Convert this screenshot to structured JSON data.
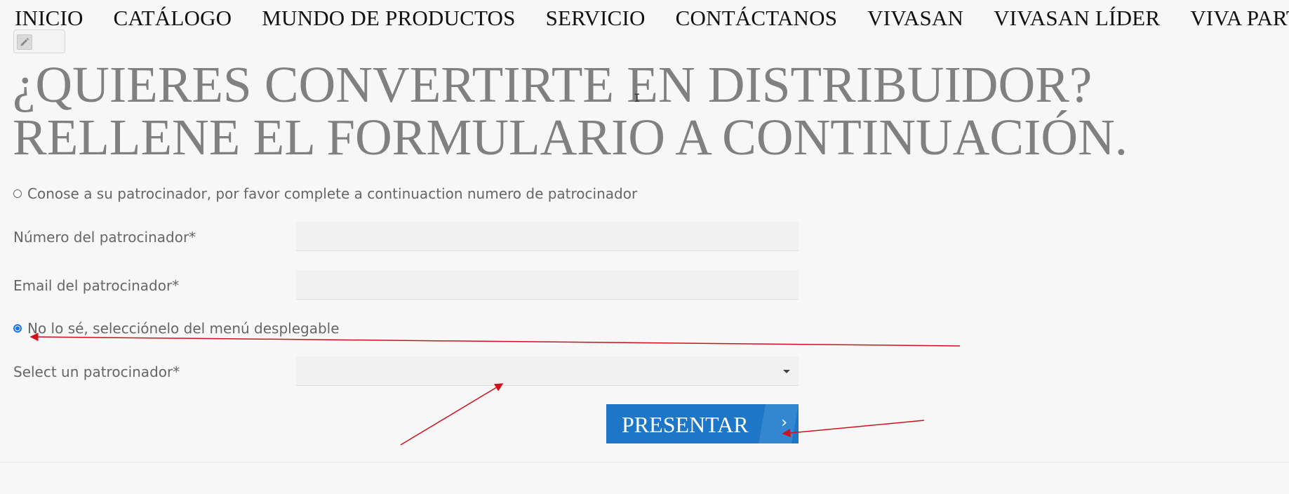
{
  "nav": {
    "items": [
      "INICIO",
      "CATÁLOGO",
      "MUNDO DE PRODUCTOS",
      "SERVICIO",
      "CONTÁCTANOS",
      "VIVASAN",
      "VIVASAN LÍDER",
      "VIVA PART"
    ]
  },
  "edit_button": {
    "icon": "pencil-icon"
  },
  "headline": {
    "line1": "¿QUIERES CONVERTIRTE EN DISTRIBUIDOR?",
    "line2": "RELLENE EL FORMULARIO A CONTINUACIÓN."
  },
  "form": {
    "option_known": "Conose a su patrocinador, por favor complete a continuaction numero de patrocinador",
    "sponsor_number_label": "Número del patrocinador*",
    "sponsor_email_label": "Email del patrocinador*",
    "option_unknown": "No lo sé, selecciónelo del menú desplegable",
    "select_label": "Select un patrocinador*",
    "selected_option": "unknown",
    "submit_label": "PRESENTAR",
    "submit_icon": "chevron-right-icon"
  },
  "colors": {
    "accent": "#1e76c6",
    "annotation": "#d0101a"
  }
}
